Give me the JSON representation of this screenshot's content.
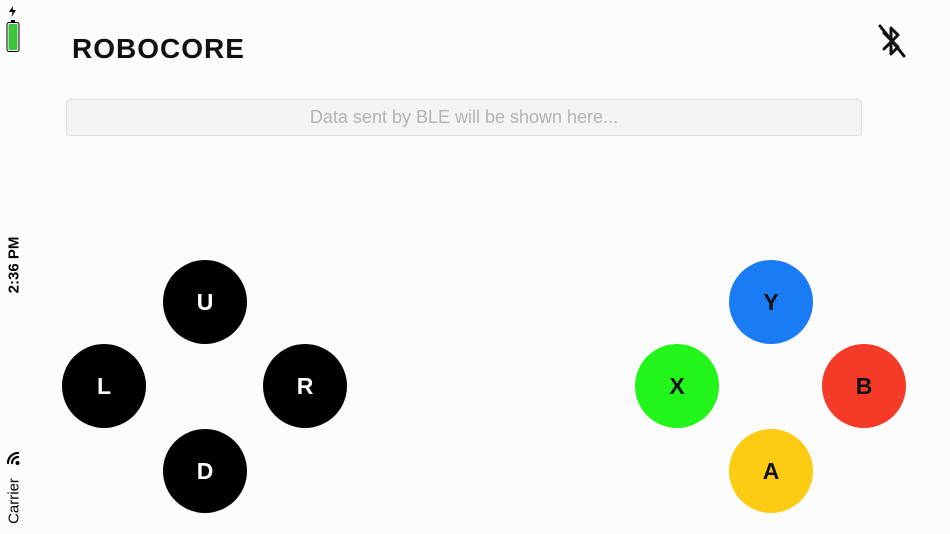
{
  "status": {
    "time": "2:36 PM",
    "carrier": "Carrier",
    "battery_color": "#3cc43c",
    "icons": [
      "battery-icon",
      "charging-bolt-icon",
      "wifi-icon"
    ]
  },
  "header": {
    "logo_text": "ROBOCORE",
    "bluetooth_icon": "bluetooth-disabled-icon"
  },
  "data_field": {
    "placeholder": "Data sent by BLE will be shown here..."
  },
  "dpad": {
    "up": "U",
    "left": "L",
    "right": "R",
    "down": "D",
    "color": "#000000"
  },
  "face_buttons": {
    "y": {
      "label": "Y",
      "color": "#1a7cf5"
    },
    "x": {
      "label": "X",
      "color": "#22f51a"
    },
    "b": {
      "label": "B",
      "color": "#f53a28"
    },
    "a": {
      "label": "A",
      "color": "#fccb12"
    }
  }
}
